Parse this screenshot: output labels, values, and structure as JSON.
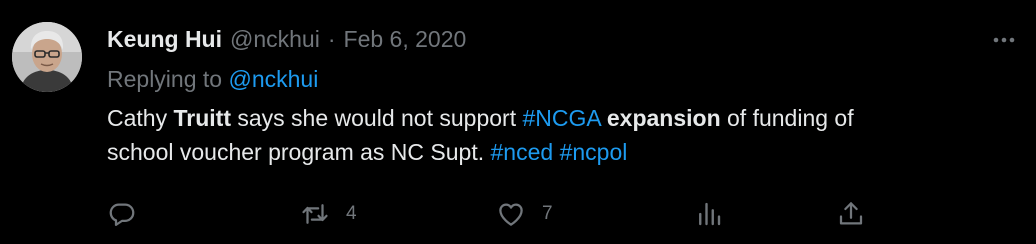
{
  "tweet": {
    "author_name": "Keung Hui",
    "author_handle": "@nckhui",
    "separator": "·",
    "date": "Feb 6, 2020",
    "replying_prefix": "Replying to",
    "replying_handle": "@nckhui",
    "text": {
      "line1": [
        {
          "text": "Cathy ",
          "style": "plain"
        },
        {
          "text": "Truitt",
          "style": "bold"
        },
        {
          "text": " says she would not support ",
          "style": "plain"
        },
        {
          "text": "#NCGA",
          "style": "hashtag"
        },
        {
          "text": " ",
          "style": "plain"
        },
        {
          "text": "expansion",
          "style": "bold"
        },
        {
          "text": " of funding of",
          "style": "plain"
        }
      ],
      "line2": [
        {
          "text": "school voucher program as NC Supt. ",
          "style": "plain"
        },
        {
          "text": "#nced",
          "style": "hashtag"
        },
        {
          "text": " ",
          "style": "plain"
        },
        {
          "text": "#ncpol",
          "style": "hashtag"
        }
      ]
    },
    "actions": {
      "reply": {
        "icon": "reply-icon"
      },
      "retweet": {
        "icon": "retweet-icon",
        "count": "4"
      },
      "like": {
        "icon": "heart-icon",
        "count": "7"
      },
      "views": {
        "icon": "analytics-icon"
      },
      "share": {
        "icon": "share-icon"
      }
    }
  },
  "colors": {
    "background": "#000000",
    "text_primary": "#e7e9ea",
    "text_secondary": "#71767b",
    "accent": "#1d9bf0"
  }
}
